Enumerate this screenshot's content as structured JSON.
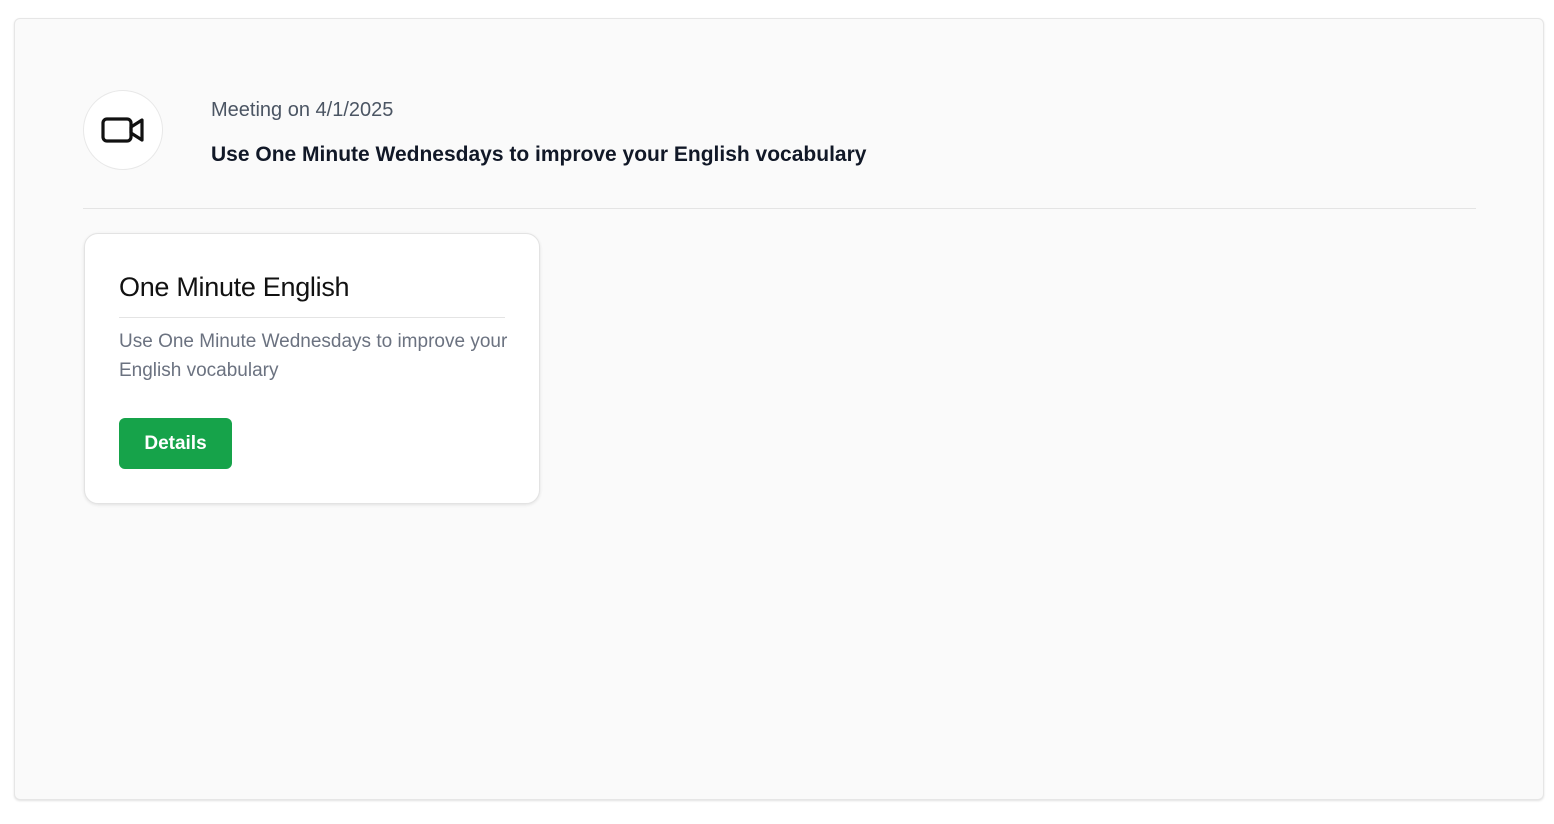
{
  "meeting": {
    "icon": "video-camera-icon",
    "date_label": "Meeting on 4/1/2025",
    "title": "Use One Minute Wednesdays to improve your English vocabulary"
  },
  "card": {
    "title": "One Minute English",
    "description": "Use One Minute Wednesdays to improve your English vocabulary",
    "details_label": "Details"
  },
  "colors": {
    "accent": "#16a34a",
    "panel_background": "#fafafa"
  }
}
